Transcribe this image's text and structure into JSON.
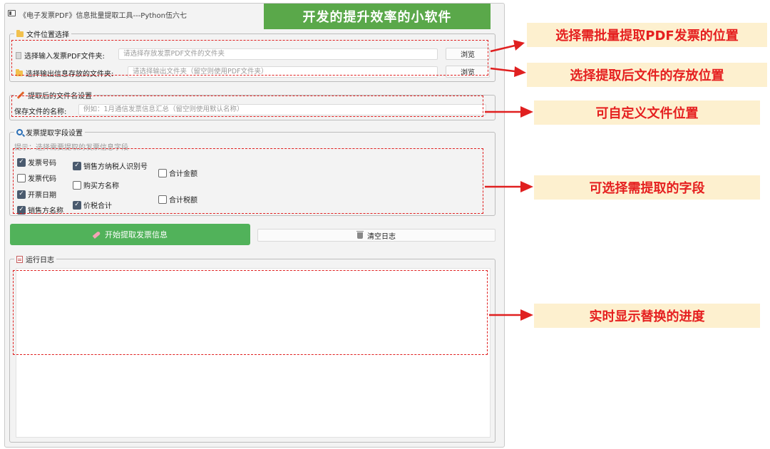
{
  "window": {
    "title": "《电子发票PDF》信息批量提取工具---Python伍六七"
  },
  "banner": "开发的提升效率的小软件",
  "file_location": {
    "group_title": "文件位置选择",
    "input_label": "选择输入发票PDF文件夹:",
    "input_placeholder": "请选择存放发票PDF文件的文件夹",
    "output_label": "选择输出信息存放的文件夹:",
    "output_placeholder": "请选择输出文件夹（留空则使用PDF文件夹）",
    "browse_label": "浏览"
  },
  "filename_settings": {
    "group_title": "提取后的文件名设置",
    "label": "保存文件的名称:",
    "placeholder": "例如：1月通信发票信息汇总（留空则使用默认名称）"
  },
  "fields": {
    "group_title": "发票提取字段设置",
    "hint": "提示：选择需要提取的发票信息字段",
    "items": [
      {
        "label": "发票号码",
        "checked": true
      },
      {
        "label": "发票代码",
        "checked": false
      },
      {
        "label": "开票日期",
        "checked": true
      },
      {
        "label": "销售方名称",
        "checked": true
      },
      {
        "label": "销售方纳税人识别号",
        "checked": true
      },
      {
        "label": "购买方名称",
        "checked": false
      },
      {
        "label": "价税合计",
        "checked": true
      },
      {
        "label": "合计金额",
        "checked": false
      },
      {
        "label": "合计税额",
        "checked": false
      }
    ]
  },
  "actions": {
    "start_label": "开始提取发票信息",
    "clear_label": "清空日志"
  },
  "log": {
    "group_title": "运行日志"
  },
  "callouts": [
    "选择需批量提取PDF发票的位置",
    "选择提取后文件的存放位置",
    "可自定义文件位置",
    "可选择需提取的字段",
    "实时显示替换的进度"
  ],
  "colors": {
    "banner_bg": "#5aa84a",
    "start_button_bg": "#51b25a",
    "annotation_red": "#e02020",
    "callout_bg": "#fdf0cf"
  }
}
